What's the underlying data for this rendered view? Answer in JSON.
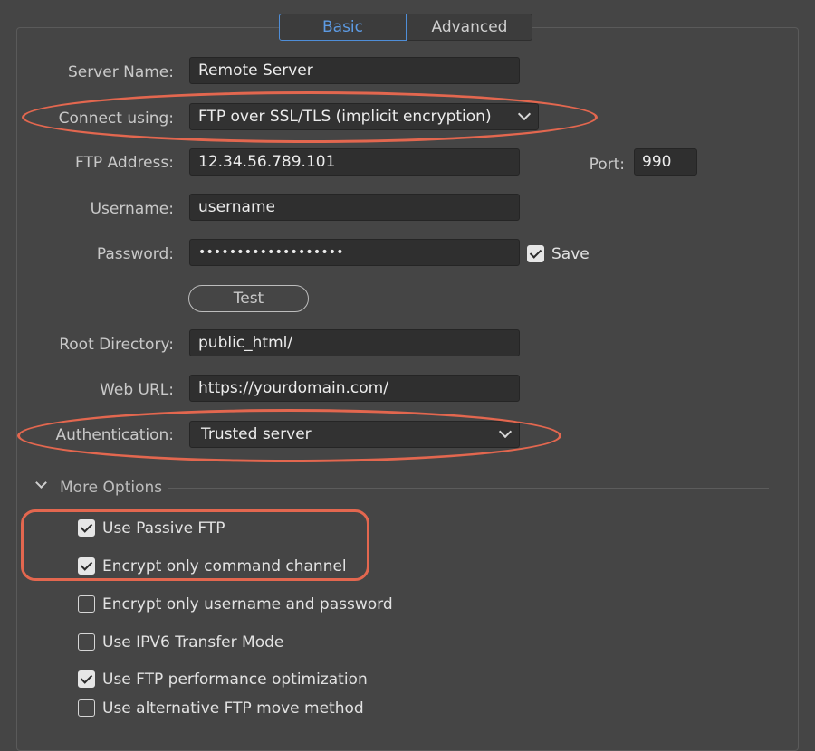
{
  "tabs": {
    "basic": "Basic",
    "advanced": "Advanced"
  },
  "form": {
    "server_name": {
      "label": "Server Name:",
      "value": "Remote Server"
    },
    "connect_using": {
      "label": "Connect using:",
      "value": "FTP over SSL/TLS (implicit encryption)"
    },
    "ftp_address": {
      "label": "FTP Address:",
      "value": "12.34.56.789.101"
    },
    "port": {
      "label": "Port:",
      "value": "990"
    },
    "username": {
      "label": "Username:",
      "value": "username"
    },
    "password": {
      "label": "Password:",
      "value": "•••••••••••••••••••",
      "save_label": "Save",
      "save_checked": true
    },
    "test_button": "Test",
    "root_directory": {
      "label": "Root Directory:",
      "value": "public_html/"
    },
    "web_url": {
      "label": "Web URL:",
      "value": "https://yourdomain.com/"
    },
    "authentication": {
      "label": "Authentication:",
      "value": "Trusted server"
    }
  },
  "more_options": {
    "label": "More Options",
    "options": [
      {
        "label": "Use Passive FTP",
        "checked": true
      },
      {
        "label": "Encrypt only command channel",
        "checked": true
      },
      {
        "label": "Encrypt only username and password",
        "checked": false
      },
      {
        "label": "Use IPV6 Transfer Mode",
        "checked": false
      },
      {
        "label": "Use FTP performance optimization",
        "checked": true
      },
      {
        "label": "Use alternative FTP move method",
        "checked": false
      }
    ]
  },
  "colors": {
    "background": "#454545",
    "field_background": "#2f2f2f",
    "accent_blue": "#4f8ed8",
    "annotation_orange": "#e3674f"
  },
  "icons": {
    "select_arrow": "chevron-down-icon",
    "checkbox": "checkmark-icon",
    "expander": "chevron-down-icon"
  }
}
